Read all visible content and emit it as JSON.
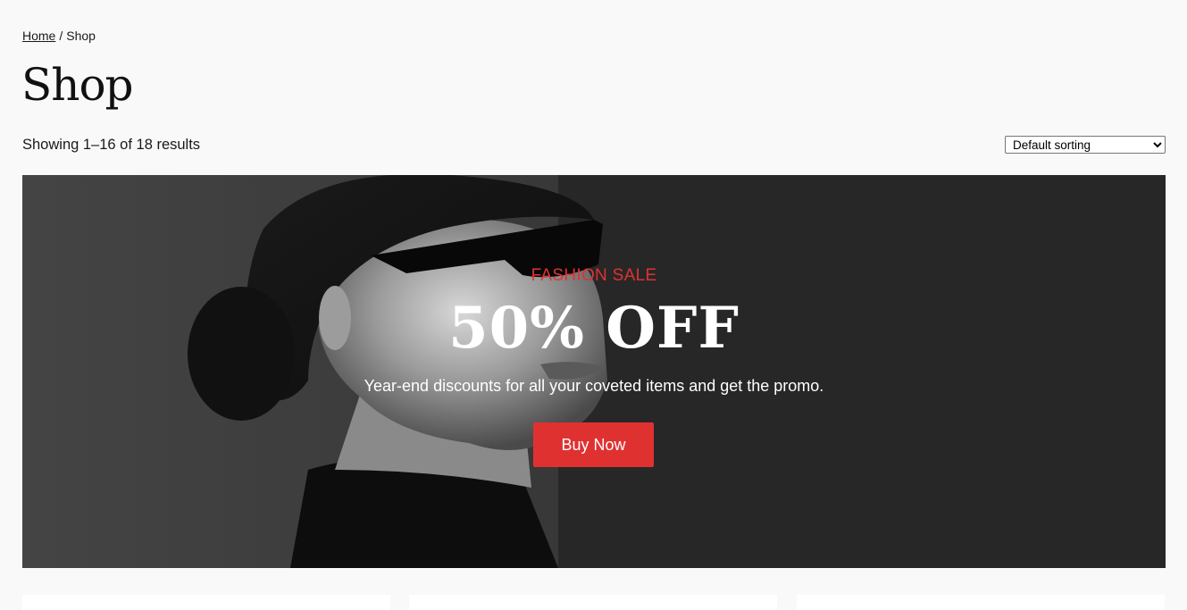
{
  "breadcrumb": {
    "home": "Home",
    "separator": "/",
    "current": "Shop"
  },
  "page": {
    "title": "Shop",
    "result_count": "Showing 1–16 of 18 results"
  },
  "sorting": {
    "selected": "Default sorting",
    "options": [
      "Default sorting"
    ]
  },
  "hero": {
    "eyebrow": "FASHION SALE",
    "heading": "50% OFF",
    "subtitle": "Year-end discounts for all your coveted items and get the promo.",
    "button_label": "Buy Now",
    "accent_color": "#e03131"
  },
  "product_cards": [
    {},
    {},
    {}
  ]
}
